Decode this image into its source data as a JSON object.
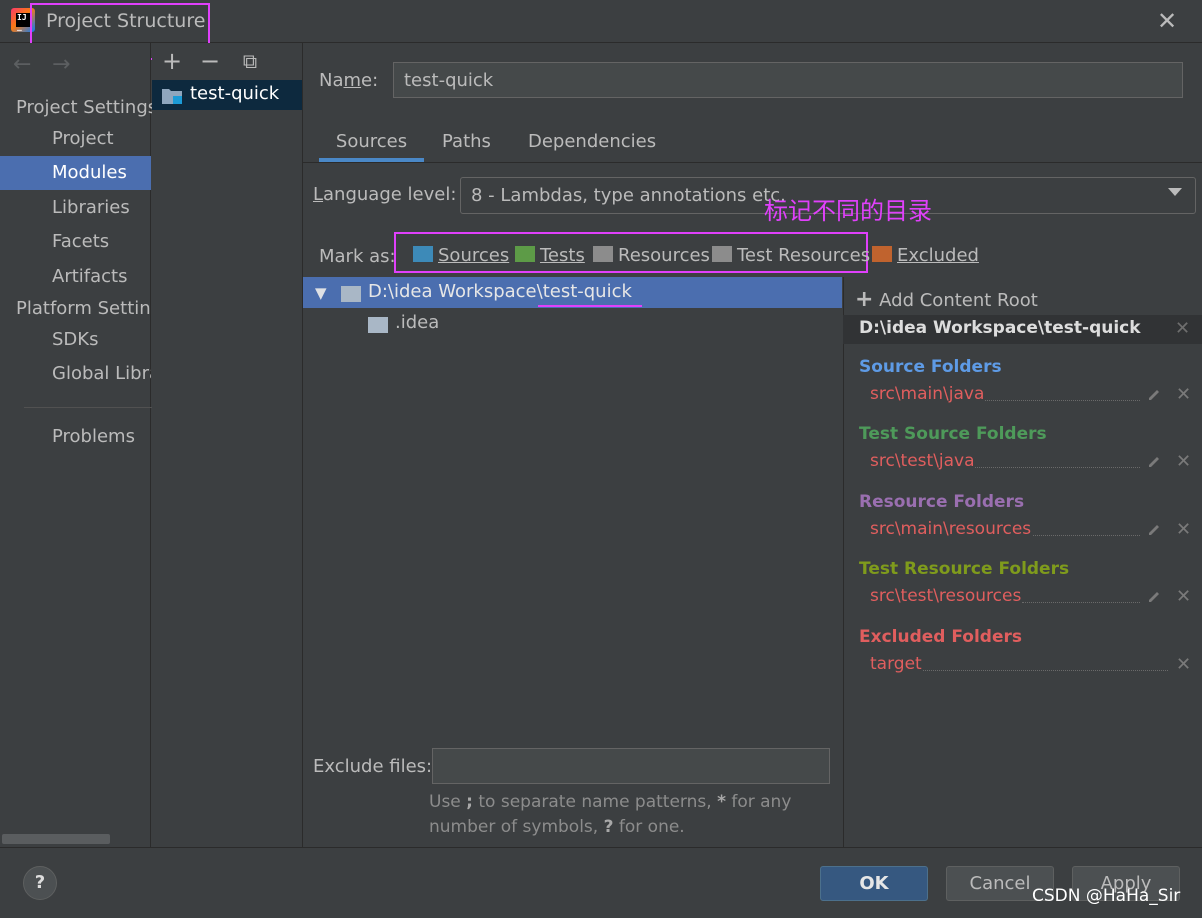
{
  "window": {
    "title": "Project Structure",
    "close_glyph": "✕"
  },
  "nav": {
    "back_glyph": "←",
    "forward_glyph": "→",
    "project_settings_header": "Project Settings",
    "project_settings_items": [
      "Project",
      "Modules",
      "Libraries",
      "Facets",
      "Artifacts"
    ],
    "selected": "Modules",
    "platform_settings_header": "Platform Settings",
    "platform_settings_items": [
      "SDKs",
      "Global Libraries"
    ],
    "problems": "Problems"
  },
  "modules": {
    "toolbar": {
      "add": "+",
      "remove": "−",
      "copy": "⧉"
    },
    "items": [
      "test-quick"
    ]
  },
  "main": {
    "name_label": "Name:",
    "name_value": "test-quick",
    "tabs": [
      "Sources",
      "Paths",
      "Dependencies"
    ],
    "active_tab": "Sources",
    "language_level_label": "Language level:",
    "language_level_value": "8 - Lambdas, type annotations etc.",
    "annotation": "标记不同的目录",
    "mark_as_label": "Mark as:",
    "mark_as": [
      {
        "label": "Sources",
        "color": "#3d8ab8"
      },
      {
        "label": "Tests",
        "color": "#5d9b47"
      },
      {
        "label": "Resources",
        "color": "#8c8c8c"
      },
      {
        "label": "Test Resources",
        "color": "#8c8c8c"
      },
      {
        "label": "Excluded",
        "color": "#c0632e"
      }
    ],
    "tree": {
      "root_path": "D:\\idea Workspace\\test-quick",
      "children": [
        ".idea"
      ]
    },
    "exclude_label": "Exclude files:",
    "exclude_value": "",
    "exclude_hint_parts": [
      "Use ",
      ";",
      " to separate name patterns, ",
      "*",
      " for any number of symbols, ",
      "?",
      " for one."
    ]
  },
  "content_roots": {
    "add_label": "Add Content Root",
    "root_path": "D:\\idea Workspace\\test-quick",
    "groups": [
      {
        "title": "Source Folders",
        "color": "#5e9be6",
        "path": "src\\main\\java",
        "editable": true
      },
      {
        "title": "Test Source Folders",
        "color": "#4e9a5a",
        "path": "src\\test\\java",
        "editable": true
      },
      {
        "title": "Resource Folders",
        "color": "#9a6fb0",
        "path": "src\\main\\resources",
        "editable": true
      },
      {
        "title": "Test Resource Folders",
        "color": "#7f9b1c",
        "path": "src\\test\\resources",
        "editable": true
      },
      {
        "title": "Excluded Folders",
        "color": "#e05e5e",
        "path": "target",
        "editable": false
      }
    ]
  },
  "buttons": {
    "help": "?",
    "ok": "OK",
    "cancel": "Cancel",
    "apply": "Apply"
  },
  "watermark": "CSDN @HaHa_Sir",
  "colors": {
    "accent": "#4b6eaf",
    "annotation": "#e040fb",
    "background": "#3c3f41"
  }
}
